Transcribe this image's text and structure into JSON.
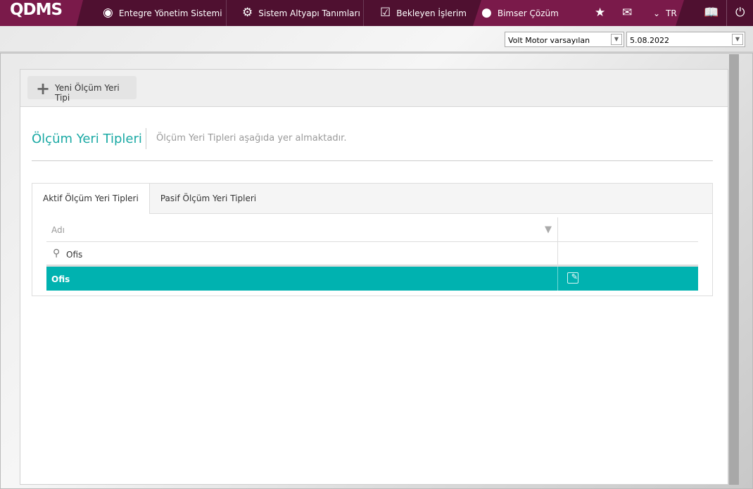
{
  "topbar": {
    "logo": "QDMS",
    "items": [
      {
        "label": "Entegre Yönetim Sistemi",
        "icon": "q-logo-icon"
      },
      {
        "label": "Sistem Altyapı Tanımları",
        "icon": "gear-icon"
      },
      {
        "label": "Bekleyen İşlerim",
        "icon": "clipboard-icon"
      },
      {
        "label": "Bimser Çözüm",
        "icon": "user-icon"
      }
    ],
    "language": "TR"
  },
  "selectors": {
    "company": "Volt Motor varsayılan",
    "date": "5.08.2022"
  },
  "toolbar": {
    "add_label": "Yeni Ölçüm Yeri Tipi"
  },
  "page": {
    "title": "Ölçüm Yeri Tipleri",
    "description": "Ölçüm Yeri Tipleri aşağıda yer almaktadır."
  },
  "tabs": [
    {
      "label": "Aktif Ölçüm Yeri Tipleri",
      "active": true
    },
    {
      "label": "Pasif Ölçüm Yeri Tipleri",
      "active": false
    }
  ],
  "grid": {
    "column_header": "Adı",
    "search_value": "Ofis",
    "rows": [
      {
        "name": "Ofis"
      }
    ]
  },
  "colors": {
    "topbar": "#4f1030",
    "accent": "#7a1a4a",
    "teal": "#00b2b0"
  }
}
